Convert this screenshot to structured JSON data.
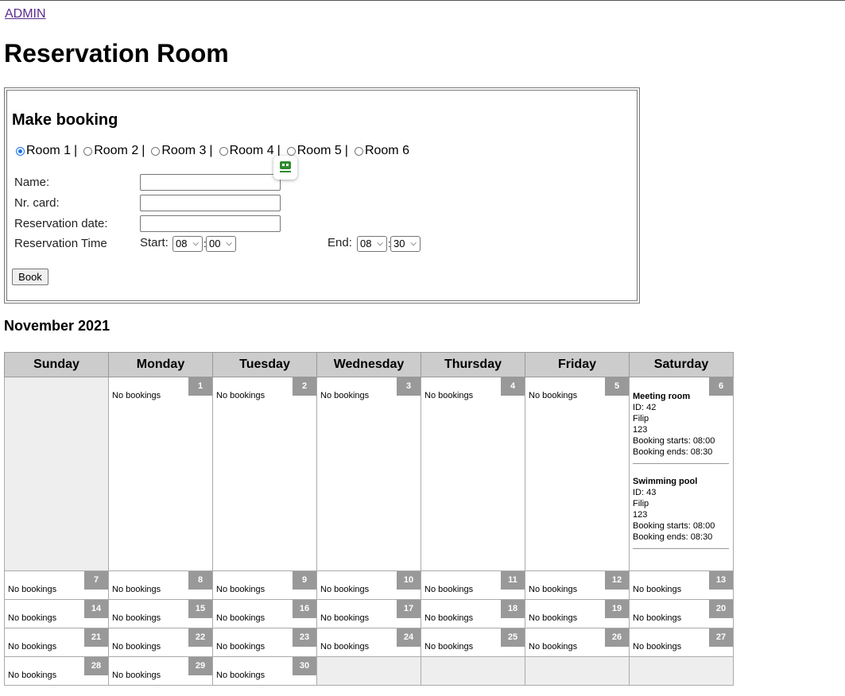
{
  "nav": {
    "admin_link": "ADMIN"
  },
  "page_title": "Reservation Room",
  "booking_form": {
    "title": "Make booking",
    "rooms": [
      "Room 1",
      "Room 2",
      "Room 3",
      "Room 4",
      "Room 5",
      "Room 6"
    ],
    "selected_room": "Room 1",
    "fields": {
      "name_label": "Name:",
      "card_label": "Nr. card:",
      "date_label": "Reservation date:",
      "time_label": "Reservation Time"
    },
    "start_label": "Start:",
    "end_label": "End:",
    "start_hour": "08",
    "start_minute": "00",
    "end_hour": "08",
    "end_minute": "30",
    "time_separator": ":",
    "book_button": "Book"
  },
  "calendar": {
    "month_title": "November 2021",
    "weekdays": [
      "Sunday",
      "Monday",
      "Tuesday",
      "Wednesday",
      "Thursday",
      "Friday",
      "Saturday"
    ],
    "no_bookings_text": "No bookings",
    "weeks": [
      [
        null,
        1,
        2,
        3,
        4,
        5,
        6
      ],
      [
        7,
        8,
        9,
        10,
        11,
        12,
        13
      ],
      [
        14,
        15,
        16,
        17,
        18,
        19,
        20
      ],
      [
        21,
        22,
        23,
        24,
        25,
        26,
        27
      ],
      [
        28,
        29,
        30,
        null,
        null,
        null,
        null
      ]
    ],
    "bookings": {
      "6": [
        {
          "room": "Meeting room",
          "id": "ID: 42",
          "name": "Filip",
          "card": "123",
          "starts": "Booking starts: 08:00",
          "ends": "Booking ends: 08:30"
        },
        {
          "room": "Swimming pool",
          "id": "ID: 43",
          "name": "Filip",
          "card": "123",
          "starts": "Booking starts: 08:00",
          "ends": "Booking ends: 08:30"
        }
      ]
    }
  },
  "colors": {
    "header_bg": "#cccccc",
    "day_number_bg": "#999999",
    "empty_cell_bg": "#eeeeee",
    "link": "#5b2c8d",
    "radio_checked": "#1a73e8"
  }
}
